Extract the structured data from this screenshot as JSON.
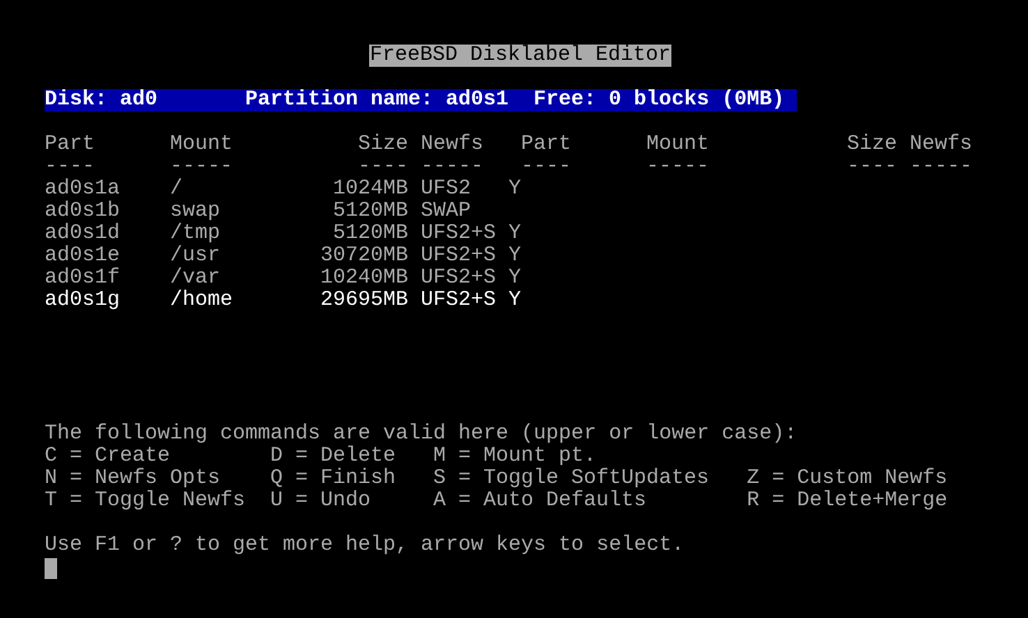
{
  "title": "FreeBSD Disklabel Editor",
  "info_bar": {
    "disk": "Disk: ad0",
    "partition": "Partition name: ad0s1",
    "free": "Free: 0 blocks (0MB)"
  },
  "columns": [
    {
      "label": "Part",
      "rule": "----"
    },
    {
      "label": "Mount",
      "rule": "-----"
    },
    {
      "label": "Size",
      "rule": "----"
    },
    {
      "label": "Newfs",
      "rule": "-----"
    },
    {
      "label": "Part",
      "rule": "----"
    },
    {
      "label": "Mount",
      "rule": "-----"
    },
    {
      "label": "Size",
      "rule": "----"
    },
    {
      "label": "Newfs",
      "rule": "-----"
    }
  ],
  "rows": [
    {
      "part": "ad0s1a",
      "mount": "/",
      "size": "1024MB",
      "newfs": "UFS2",
      "flag": "Y",
      "selected": false
    },
    {
      "part": "ad0s1b",
      "mount": "swap",
      "size": "5120MB",
      "newfs": "SWAP",
      "selected": false
    },
    {
      "part": "ad0s1d",
      "mount": "/tmp",
      "size": "5120MB",
      "newfs": "UFS2+S",
      "flag": "Y",
      "selected": false
    },
    {
      "part": "ad0s1e",
      "mount": "/usr",
      "size": "30720MB",
      "newfs": "UFS2+S",
      "flag": "Y",
      "selected": false
    },
    {
      "part": "ad0s1f",
      "mount": "/var",
      "size": "10240MB",
      "newfs": "UFS2+S",
      "flag": "Y",
      "selected": false
    },
    {
      "part": "ad0s1g",
      "mount": "/home",
      "size": "29695MB",
      "newfs": "UFS2+S",
      "flag": "Y",
      "selected": true
    }
  ],
  "commands_intro": "The following commands are valid here (upper or lower case):",
  "commands": [
    [
      "C = Create",
      "D = Delete",
      "M = Mount pt."
    ],
    [
      "N = Newfs Opts",
      "Q = Finish",
      "S = Toggle SoftUpdates",
      "Z = Custom Newfs"
    ],
    [
      "T = Toggle Newfs",
      "U = Undo",
      "A = Auto Defaults",
      "R = Delete+Merge"
    ]
  ],
  "help": "Use F1 or ? to get more help, arrow keys to select."
}
